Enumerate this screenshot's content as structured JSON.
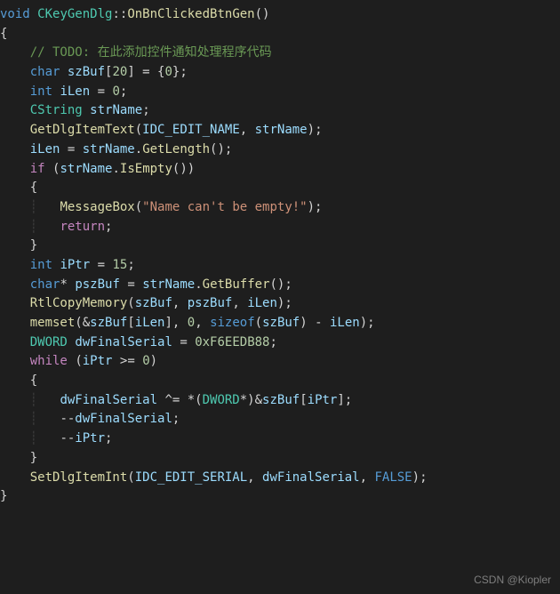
{
  "code": {
    "sig_void": "void",
    "sig_class": "CKeyGenDlg",
    "sig_sep": "::",
    "sig_method": "OnBnClickedBtnGen",
    "sig_parens": "()",
    "open_brace": "{",
    "close_brace": "}",
    "todo": "// TODO: 在此添加控件通知处理程序代码",
    "char": "char",
    "szBuf": "szBuf",
    "szBuf_decl": "[",
    "twenty": "20",
    "szBuf_decl2": "] = {",
    "zero": "0",
    "szBuf_decl3": "};",
    "int": "int",
    "iLen": "iLen",
    "eq0": " = ",
    "semi": ";",
    "CString": "CString",
    "strName": "strName",
    "GetDlgItemText": "GetDlgItemText",
    "open_p": "(",
    "close_p": ")",
    "IDC_EDIT_NAME": "IDC_EDIT_NAME",
    "comma": ", ",
    "GetLength": "GetLength",
    "dot": ".",
    "if": "if",
    "IsEmpty": "IsEmpty",
    "MessageBox": "MessageBox",
    "msg": "\"Name can't be empty!\"",
    "return": "return",
    "iPtr": "iPtr",
    "fifteen": "15",
    "star": "*",
    "pszBuf": "pszBuf",
    "GetBuffer": "GetBuffer",
    "RtlCopyMemory": "RtlCopyMemory",
    "memset": "memset",
    "amp": "&",
    "open_b": "[",
    "close_b": "]",
    "sizeof": "sizeof",
    "minus": " - ",
    "DWORD": "DWORD",
    "dwFinalSerial": "dwFinalSerial",
    "hex": "0xF6EEDB88",
    "while": "while",
    "gte": " >= ",
    "xoreq": " ^= ",
    "cast_open": "*(",
    "cast_close": "*)&",
    "dec": "--",
    "SetDlgItemInt": "SetDlgItemInt",
    "IDC_EDIT_SERIAL": "IDC_EDIT_SERIAL",
    "FALSE": "FALSE"
  },
  "watermark": "CSDN @Kiopler"
}
